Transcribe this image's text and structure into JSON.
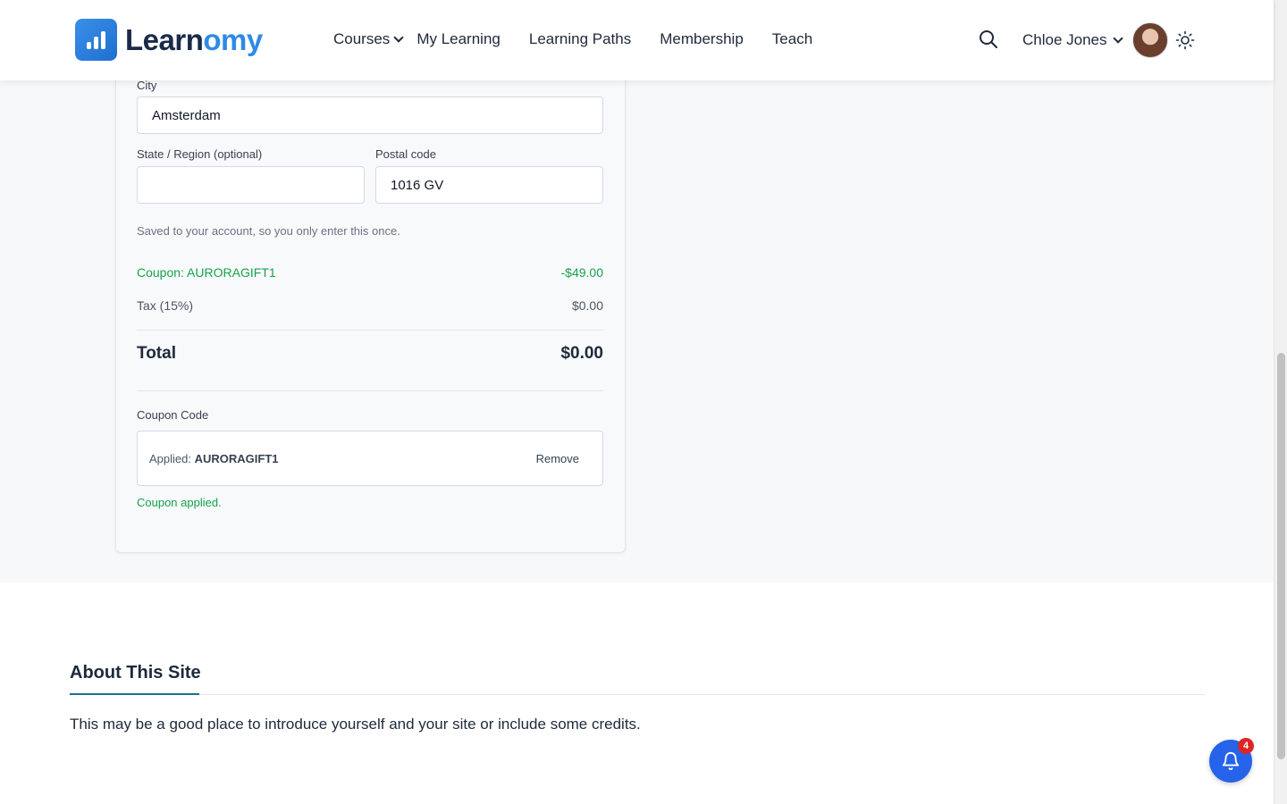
{
  "header": {
    "logo_prefix": "Learn",
    "logo_suffix": "omy",
    "nav": {
      "courses": "Courses",
      "my_learning": "My Learning",
      "learning_paths": "Learning Paths",
      "membership": "Membership",
      "teach": "Teach"
    },
    "user_name": "Chloe Jones",
    "icons": [
      "search-icon",
      "chevron-down-icon",
      "avatar",
      "sun-icon"
    ]
  },
  "form": {
    "city_label": "City",
    "city_value": "Amsterdam",
    "state_label": "State / Region (optional)",
    "state_value": "",
    "postal_label": "Postal code",
    "postal_value": "1016 GV",
    "hint": "Saved to your account, so you only enter this once."
  },
  "summary": {
    "coupon_label": "Coupon: AURORAGIFT1",
    "coupon_amount": "-$49.00",
    "tax_label": "Tax (15%)",
    "tax_amount": "$0.00",
    "total_label": "Total",
    "total_amount": "$0.00"
  },
  "coupon": {
    "section_label": "Coupon Code",
    "applied_prefix": "Applied:",
    "applied_code": "AURORAGIFT1",
    "remove_label": "Remove",
    "message": "Coupon applied."
  },
  "about": {
    "title": "About This Site",
    "text": "This may be a good place to introduce yourself and your site or include some credits."
  },
  "notifications": {
    "count": "4"
  },
  "colors": {
    "brand": "#2f8ae6",
    "success": "#16a34a",
    "bell": "#2563eb",
    "badge": "#dc2626"
  }
}
